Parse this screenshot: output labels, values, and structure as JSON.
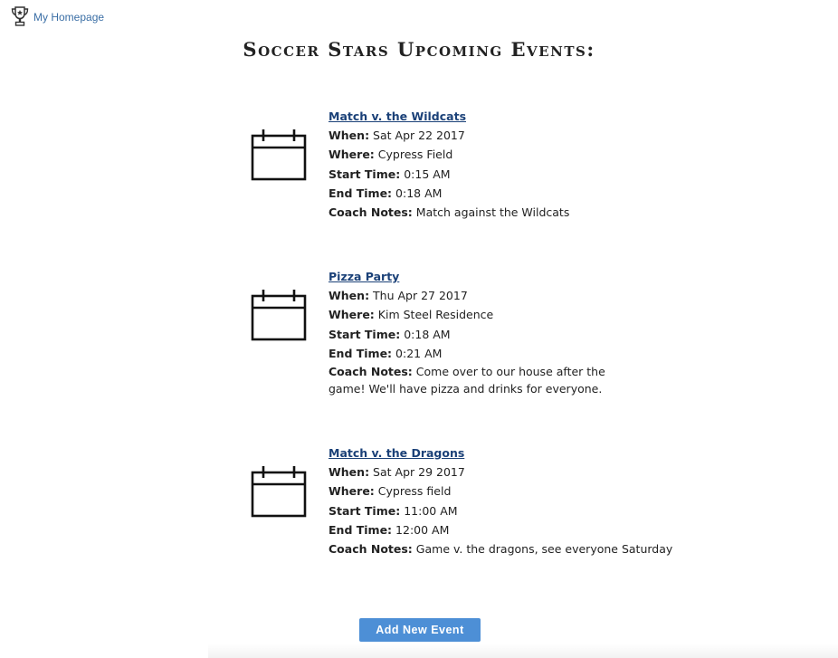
{
  "nav": {
    "home_label": "My Homepage",
    "home_icon": "trophy-icon"
  },
  "page": {
    "title": "Soccer Stars Upcoming Events:"
  },
  "labels": {
    "when": "When:",
    "where": "Where:",
    "start": "Start Time:",
    "end": "End Time:",
    "notes": "Coach Notes:"
  },
  "events": [
    {
      "title": "Match v. the Wildcats",
      "when": "Sat Apr 22 2017",
      "where": "Cypress Field",
      "start": "0:15 AM",
      "end": "0:18 AM",
      "notes": "Match against the Wildcats",
      "icon": "calendar-icon"
    },
    {
      "title": "Pizza Party",
      "when": "Thu Apr 27 2017",
      "where": "Kim Steel Residence",
      "start": "0:18 AM",
      "end": "0:21 AM",
      "notes": "Come over to our house after the game! We'll have pizza and drinks for everyone.",
      "icon": "calendar-icon"
    },
    {
      "title": "Match v. the Dragons",
      "when": "Sat Apr 29 2017",
      "where": "Cypress field",
      "start": "11:00 AM",
      "end": "12:00 AM",
      "notes": "Game v. the dragons, see everyone Saturday",
      "icon": "calendar-icon"
    }
  ],
  "actions": {
    "add_event_label": "Add New Event"
  },
  "colors": {
    "link": "#3a6ea5",
    "event_title": "#1b4178",
    "button": "#4d8fd6"
  }
}
